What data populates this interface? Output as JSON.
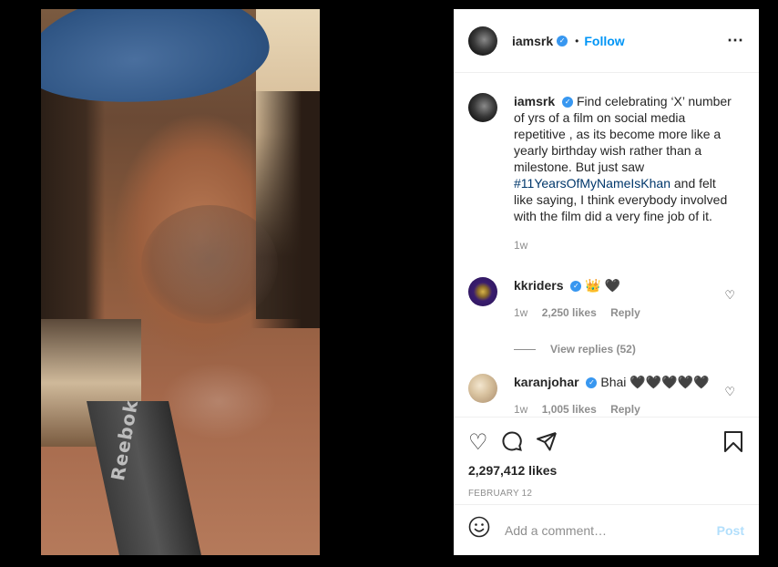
{
  "post": {
    "username": "iamsrk",
    "follow_label": "Follow",
    "dot": "•",
    "more_icon": "⋯",
    "strap_text": "Reebok",
    "caption": {
      "username": "iamsrk",
      "text_before": "Find celebrating ‘X’ number of yrs of a film on social media repetitive , as its become more like a yearly birthday wish rather than a milestone. But just saw ",
      "hashtag": "#11YearsOfMyNameIsKhan",
      "text_after": " and felt like saying, I think everybody involved with the film did a very fine job of it.",
      "time": "1w"
    },
    "comments": [
      {
        "username": "kkriders",
        "text": "👑 🖤",
        "time": "1w",
        "likes": "2,250 likes",
        "reply": "Reply"
      },
      {
        "username": "karanjohar",
        "text": "Bhai 🖤🖤🖤🖤🖤",
        "time": "1w",
        "likes": "1,005 likes",
        "reply": "Reply"
      }
    ],
    "view_replies": "View replies (52)",
    "likes": "2,297,412 likes",
    "date": "FEBRUARY 12",
    "add_comment_placeholder": "Add a comment…",
    "post_label": "Post",
    "icons": {
      "like": "heart-icon",
      "comment": "comment-icon",
      "share": "share-icon",
      "save": "bookmark-icon",
      "emoji": "emoji-icon"
    },
    "colors": {
      "link": "#0095f6",
      "verified": "#3897f0",
      "post_disabled": "#b2dffc"
    }
  }
}
